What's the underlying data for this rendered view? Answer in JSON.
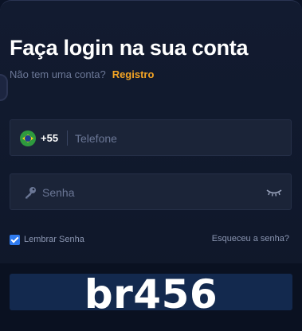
{
  "login": {
    "title": "Faça login na sua conta",
    "no_account_text": "Não tem uma conta?",
    "register_link": "Registro",
    "phone": {
      "country_code": "+55",
      "placeholder": "Telefone",
      "flag": "brazil-flag"
    },
    "password": {
      "placeholder": "Senha",
      "icon": "key-icon",
      "toggle_icon": "eye-closed-icon"
    },
    "remember_label": "Lembrar Senha",
    "remember_checked": true,
    "forgot_link": "Esqueceu a senha?",
    "watermark": "br456"
  },
  "colors": {
    "background": "#0f1729",
    "field": "#1b2438",
    "accent": "#f5a524",
    "checkbox": "#2f7bf0",
    "button": "#13294e"
  }
}
